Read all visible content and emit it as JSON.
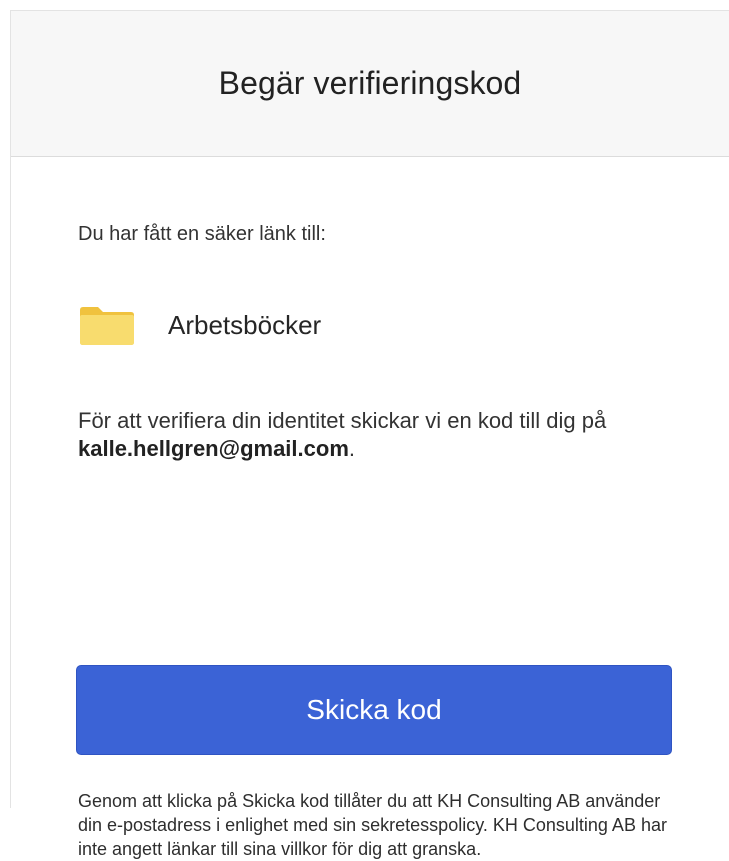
{
  "header": {
    "title": "Begär verifieringskod"
  },
  "content": {
    "intro": "Du har fått en säker länk till:",
    "item": {
      "icon": "folder-icon",
      "name": "Arbetsböcker",
      "icon_color": "#f5d45a"
    },
    "verify": {
      "text_before": "För att verifiera din identitet skickar vi en kod till dig på ",
      "email": "kalle.hellgren@gmail.com",
      "text_after": "."
    },
    "send_button": {
      "label": "Skicka kod",
      "color": "#3b63d6"
    },
    "consent": "Genom att klicka på Skicka kod tillåter du att KH Consulting AB använder din e-postadress i enlighet med sin sekretesspolicy. KH Consulting AB har inte angett länkar till sina villkor för dig att granska."
  }
}
